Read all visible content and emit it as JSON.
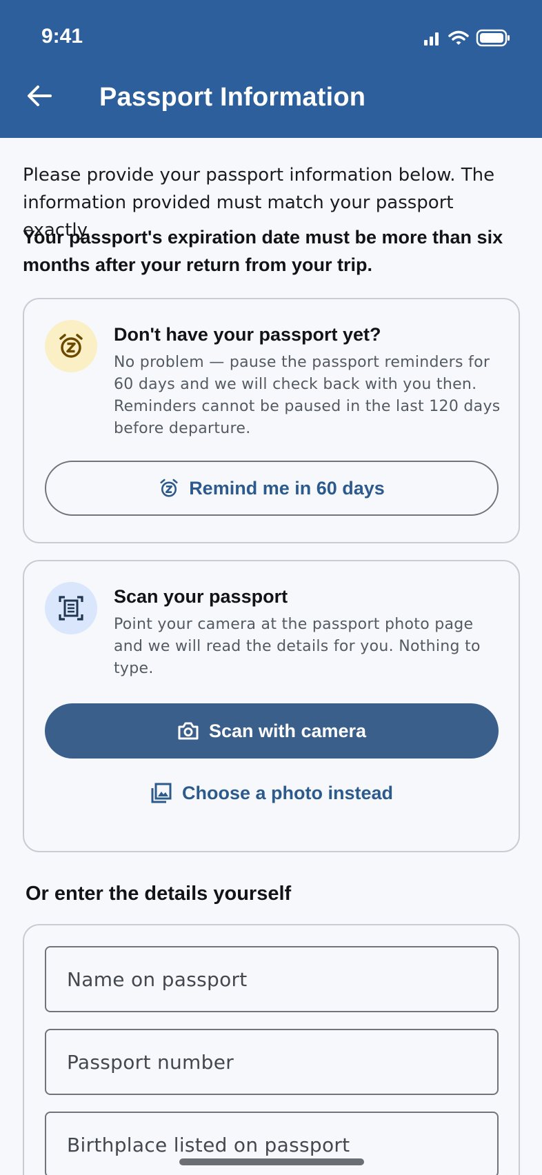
{
  "status_bar": {
    "time": "9:41",
    "icons": [
      "signal-icon",
      "wifi-icon",
      "battery-icon"
    ]
  },
  "header": {
    "back_icon": "arrow-left-icon",
    "title": "Passport Information"
  },
  "intro": {
    "text": "Please provide your passport information below. The information provided must match your passport exactly.",
    "warning": "Your passport's expiration date must be more than six months after your return from your trip."
  },
  "reminder_card": {
    "icon": "alarm-snooze-icon",
    "title": "Don't have your passport yet?",
    "body": "No problem — pause the passport reminders for 60 days and we will check back with you then. Reminders cannot be paused in the last 120 days before departure.",
    "button_label": "Remind me in 60 days"
  },
  "scan_card": {
    "icon": "document-scan-icon",
    "title": "Scan your passport",
    "body": "Point your camera at the passport photo page and we will read the details for you. Nothing to type.",
    "camera_button_label": "Scan with camera",
    "photo_button_label": "Choose a photo instead"
  },
  "manual_section": {
    "heading": "Or enter the details yourself",
    "fields": [
      {
        "placeholder": "Name on passport",
        "value": ""
      },
      {
        "placeholder": "Passport number",
        "value": ""
      },
      {
        "placeholder": "Birthplace listed on passport",
        "value": ""
      }
    ]
  },
  "colors": {
    "header_bg": "#2c5f9b",
    "primary_button": "#3a5f8b",
    "accent_text": "#2d5a8c",
    "page_bg": "#f6f8fc"
  }
}
